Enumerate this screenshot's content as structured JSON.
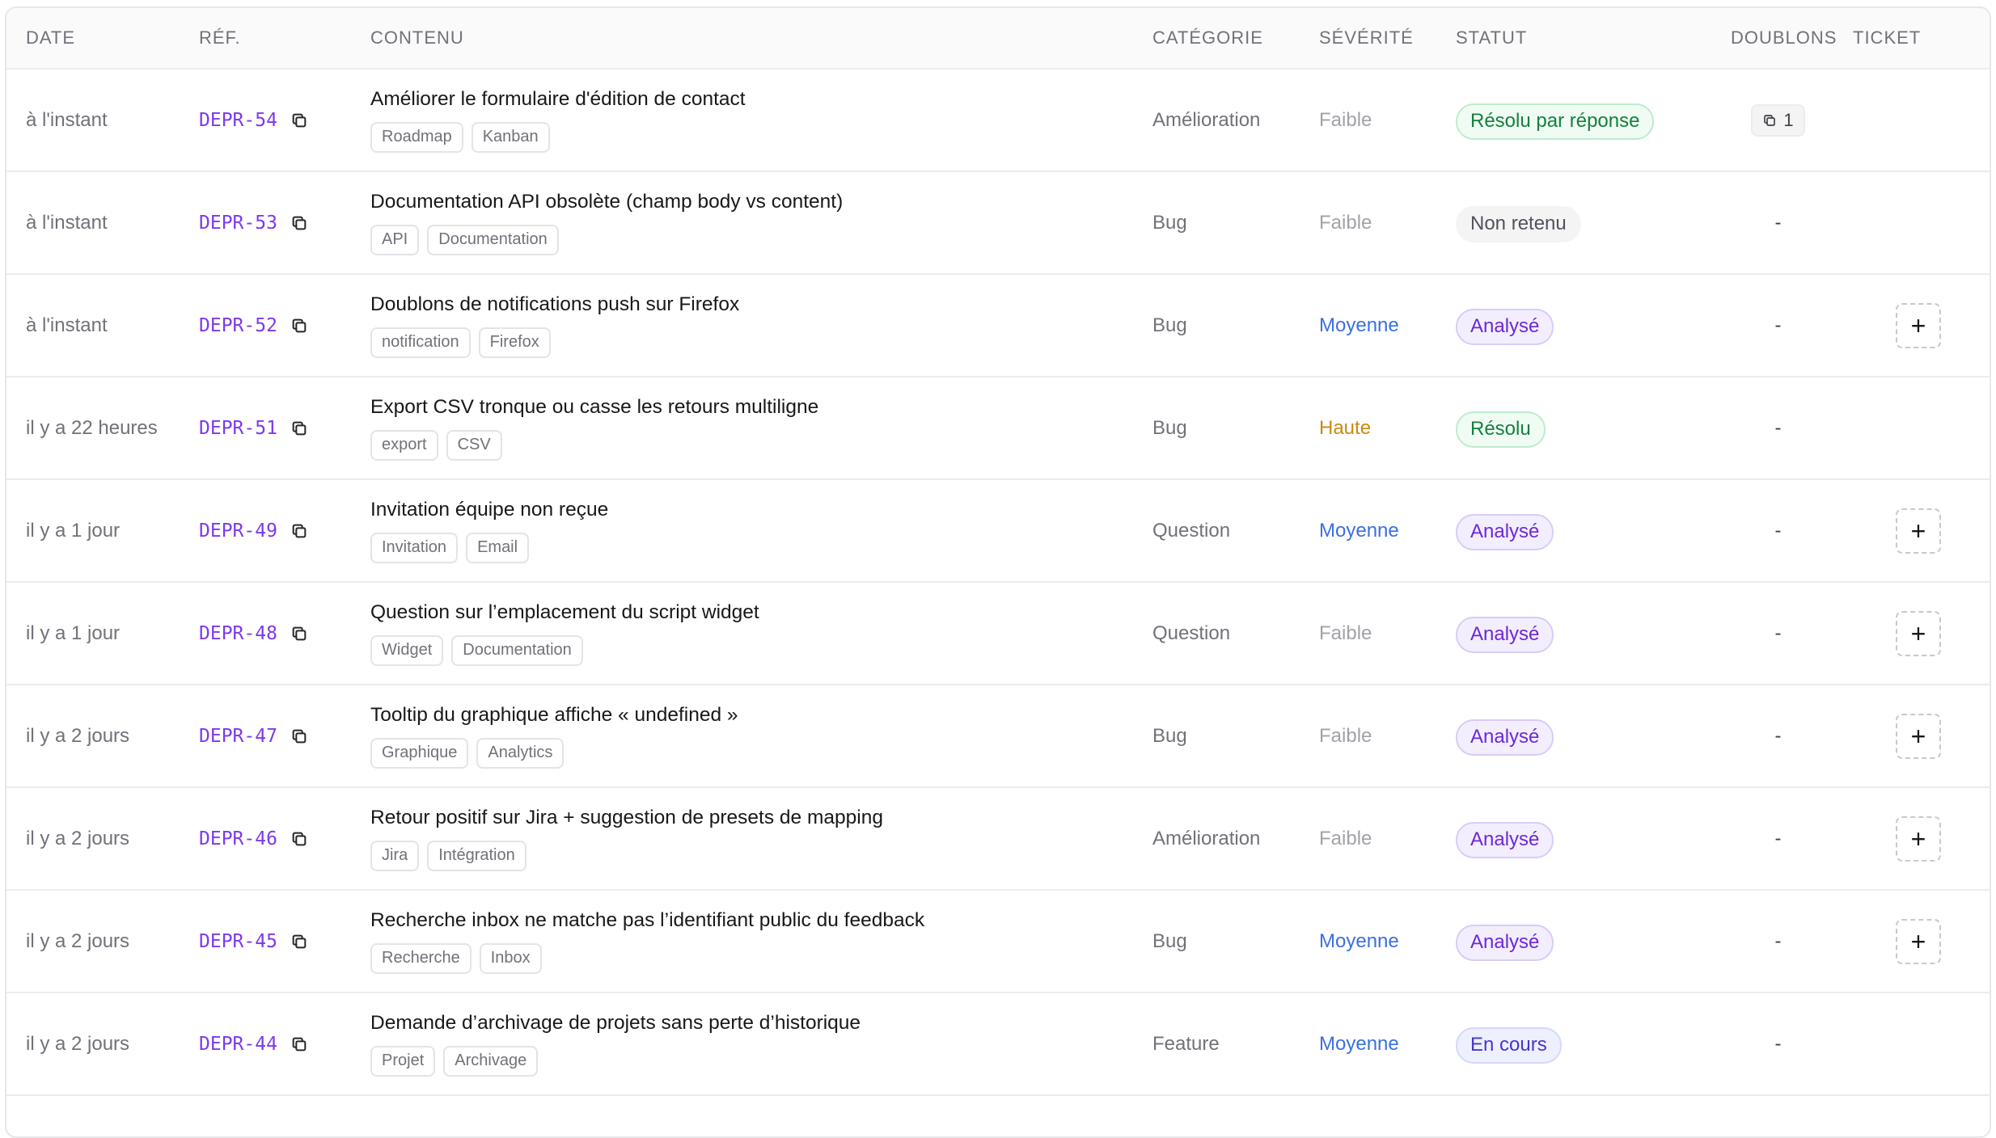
{
  "headers": {
    "date": "DATE",
    "ref": "RÉF.",
    "content": "CONTENU",
    "category": "CATÉGORIE",
    "severity": "SÉVÉRITÉ",
    "status": "STATUT",
    "duplicates": "DOUBLONS",
    "ticket": "TICKET"
  },
  "colors": {
    "ref": "#7c3aed",
    "severity_faible": "#a1a1aa",
    "severity_moyenne": "#3b6fe0",
    "severity_haute": "#c98a0c",
    "status_resolved": "#15803d",
    "status_analyzed": "#6d28d9",
    "status_in_progress": "#4338ca"
  },
  "rows": [
    {
      "date": "à l'instant",
      "ref": "DEPR-54",
      "title": "Améliorer le formulaire d'édition de contact",
      "tags": [
        "Roadmap",
        "Kanban"
      ],
      "category": "Amélioration",
      "severity": "Faible",
      "severity_level": "faible",
      "status": "Résolu par réponse",
      "status_kind": "resolved",
      "duplicates": "1",
      "ticket_action": false
    },
    {
      "date": "à l'instant",
      "ref": "DEPR-53",
      "title": "Documentation API obsolète (champ body vs content)",
      "tags": [
        "API",
        "Documentation"
      ],
      "category": "Bug",
      "severity": "Faible",
      "severity_level": "faible",
      "status": "Non retenu",
      "status_kind": "rejected",
      "duplicates": "-",
      "ticket_action": false
    },
    {
      "date": "à l'instant",
      "ref": "DEPR-52",
      "title": "Doublons de notifications push sur Firefox",
      "tags": [
        "notification",
        "Firefox"
      ],
      "category": "Bug",
      "severity": "Moyenne",
      "severity_level": "moyenne",
      "status": "Analysé",
      "status_kind": "analyzed",
      "duplicates": "-",
      "ticket_action": true
    },
    {
      "date": "il y a 22 heures",
      "ref": "DEPR-51",
      "title": "Export CSV tronque ou casse les retours multiligne",
      "tags": [
        "export",
        "CSV"
      ],
      "category": "Bug",
      "severity": "Haute",
      "severity_level": "haute",
      "status": "Résolu",
      "status_kind": "resolved",
      "duplicates": "-",
      "ticket_action": false
    },
    {
      "date": "il y a 1 jour",
      "ref": "DEPR-49",
      "title": "Invitation équipe non reçue",
      "tags": [
        "Invitation",
        "Email"
      ],
      "category": "Question",
      "severity": "Moyenne",
      "severity_level": "moyenne",
      "status": "Analysé",
      "status_kind": "analyzed",
      "duplicates": "-",
      "ticket_action": true
    },
    {
      "date": "il y a 1 jour",
      "ref": "DEPR-48",
      "title": "Question sur l’emplacement du script widget",
      "tags": [
        "Widget",
        "Documentation"
      ],
      "category": "Question",
      "severity": "Faible",
      "severity_level": "faible",
      "status": "Analysé",
      "status_kind": "analyzed",
      "duplicates": "-",
      "ticket_action": true
    },
    {
      "date": "il y a 2 jours",
      "ref": "DEPR-47",
      "title": "Tooltip du graphique affiche « undefined »",
      "tags": [
        "Graphique",
        "Analytics"
      ],
      "category": "Bug",
      "severity": "Faible",
      "severity_level": "faible",
      "status": "Analysé",
      "status_kind": "analyzed",
      "duplicates": "-",
      "ticket_action": true
    },
    {
      "date": "il y a 2 jours",
      "ref": "DEPR-46",
      "title": "Retour positif sur Jira + suggestion de presets de mapping",
      "tags": [
        "Jira",
        "Intégration"
      ],
      "category": "Amélioration",
      "severity": "Faible",
      "severity_level": "faible",
      "status": "Analysé",
      "status_kind": "analyzed",
      "duplicates": "-",
      "ticket_action": true
    },
    {
      "date": "il y a 2 jours",
      "ref": "DEPR-45",
      "title": "Recherche inbox ne matche pas l’identifiant public du feedback",
      "tags": [
        "Recherche",
        "Inbox"
      ],
      "category": "Bug",
      "severity": "Moyenne",
      "severity_level": "moyenne",
      "status": "Analysé",
      "status_kind": "analyzed",
      "duplicates": "-",
      "ticket_action": true
    },
    {
      "date": "il y a 2 jours",
      "ref": "DEPR-44",
      "title": "Demande d’archivage de projets sans perte d’historique",
      "tags": [
        "Projet",
        "Archivage"
      ],
      "category": "Feature",
      "severity": "Moyenne",
      "severity_level": "moyenne",
      "status": "En cours",
      "status_kind": "progress",
      "duplicates": "-",
      "ticket_action": false
    }
  ],
  "ticket_add_label": "+"
}
